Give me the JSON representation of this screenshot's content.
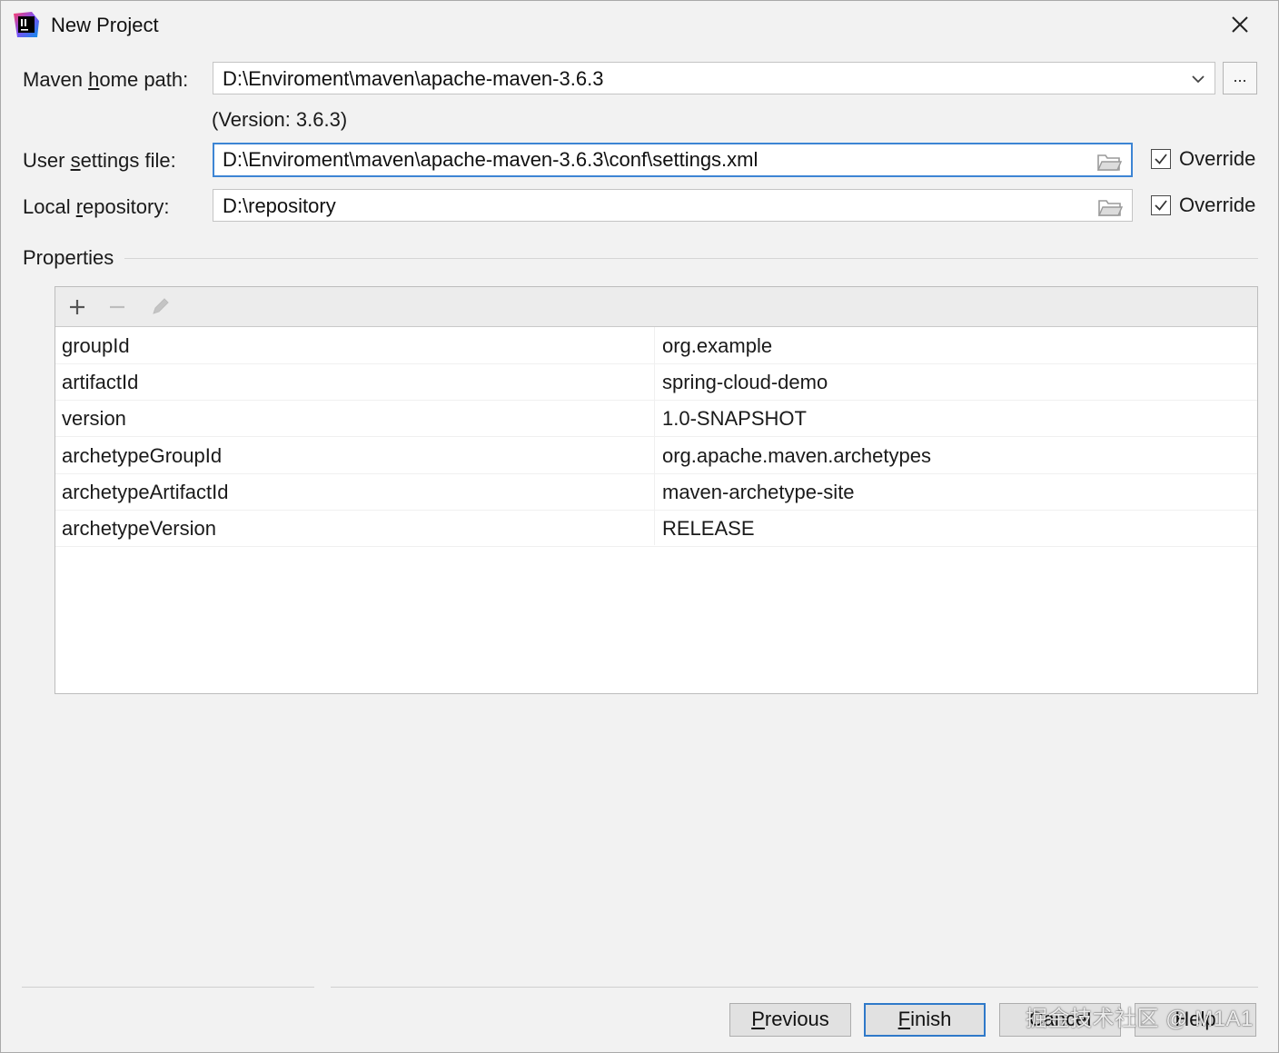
{
  "window": {
    "title": "New Project"
  },
  "maven_home": {
    "label_pre": "Maven ",
    "label_mnemonic": "h",
    "label_post": "ome path:",
    "value": "D:\\Enviroment\\maven\\apache-maven-3.6.3",
    "browse_label": "...",
    "version_text": "(Version: 3.6.3)"
  },
  "user_settings": {
    "label_pre": "User ",
    "label_mnemonic": "s",
    "label_post": "ettings file:",
    "value": "D:\\Enviroment\\maven\\apache-maven-3.6.3\\conf\\settings.xml",
    "override_label": "Override",
    "override_checked": true
  },
  "local_repo": {
    "label_pre": "Local ",
    "label_mnemonic": "r",
    "label_post": "epository:",
    "value": "D:\\repository",
    "override_label": "Override",
    "override_checked": true
  },
  "properties": {
    "title": "Properties",
    "toolbar": [
      "add-icon",
      "remove-icon",
      "edit-icon"
    ],
    "rows": [
      {
        "key": "groupId",
        "value": "org.example"
      },
      {
        "key": "artifactId",
        "value": "spring-cloud-demo"
      },
      {
        "key": "version",
        "value": "1.0-SNAPSHOT"
      },
      {
        "key": "archetypeGroupId",
        "value": "org.apache.maven.archetypes"
      },
      {
        "key": "archetypeArtifactId",
        "value": "maven-archetype-site"
      },
      {
        "key": "archetypeVersion",
        "value": "RELEASE"
      }
    ]
  },
  "footer": {
    "previous_mnemonic": "P",
    "previous_rest": "revious",
    "finish_mnemonic": "F",
    "finish_rest": "inish",
    "cancel_label": "Cancel",
    "help_label": "Help",
    "watermark": "掘金技术社区 @ M1A1"
  },
  "colors": {
    "focus_border": "#3d85d4",
    "default_button_border": "#2f79c9",
    "background": "#f2f2f2"
  }
}
